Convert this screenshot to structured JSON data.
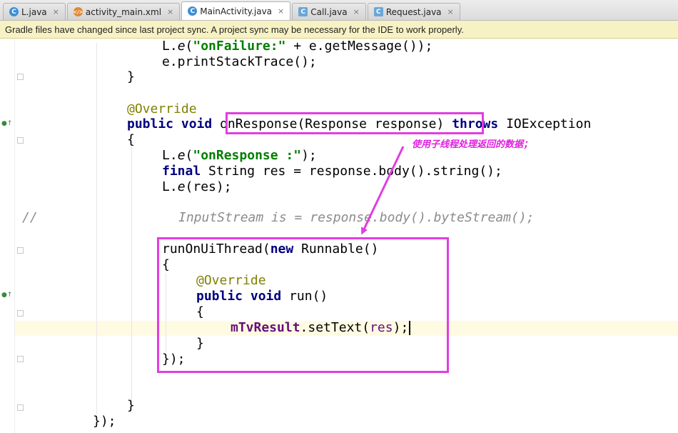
{
  "tabs": [
    {
      "icon": "C",
      "icon_name": "java-class-icon",
      "label": "L.java",
      "close": "×",
      "active": false
    },
    {
      "icon": "</>",
      "icon_name": "xml-file-icon",
      "label": "activity_main.xml",
      "close": "×",
      "active": false
    },
    {
      "icon": "C",
      "icon_name": "java-class-icon",
      "label": "MainActivity.java",
      "close": "×",
      "active": true
    },
    {
      "icon": "C",
      "icon_name": "java-interface-icon",
      "label": "Call.java",
      "close": "×",
      "active": false
    },
    {
      "icon": "C",
      "icon_name": "java-class-icon",
      "label": "Request.java",
      "close": "×",
      "active": false
    }
  ],
  "banner": {
    "message": "Gradle files have changed since last project sync. A project sync may be necessary for the IDE to work properly."
  },
  "annotation": {
    "note": "使用子线程处理返回的数据；",
    "color": "#e23de0"
  },
  "code": {
    "l1_a": "L.",
    "l1_b": "e",
    "l1_c": "(",
    "l1_d": "\"onFailure:\"",
    "l1_e": " + e.getMessage());",
    "l2": "e.printStackTrace();",
    "l3": "}",
    "l4": "@Override",
    "l5_a": "public",
    "l5_b": "void",
    "l5_c": "onResponse(Response response)",
    "l5_d": "throws",
    "l5_e": " IOException",
    "l6": "{",
    "l7_a": "L.",
    "l7_b": "e",
    "l7_c": "(",
    "l7_d": "\"onResponse :\"",
    "l7_e": ");",
    "l8_a": "final",
    "l8_b": " String res = response.body().string();",
    "l9_a": "L.",
    "l9_b": "e",
    "l9_c": "(res);",
    "l10_a": "//",
    "l10_b": "InputStream is = response.body().byteStream();",
    "l11_a": "runOnUiThread(",
    "l11_b": "new",
    "l11_c": " Runnable()",
    "l12": "{",
    "l13": "@Override",
    "l14_a": "public",
    "l14_b": "void",
    "l14_c": " run()",
    "l15": "{",
    "l16_a": "mTvResult",
    "l16_b": ".setText(",
    "l16_c": "res",
    "l16_d": ");",
    "l17": "}",
    "l18": "});",
    "l19": "}",
    "l20": "});"
  }
}
